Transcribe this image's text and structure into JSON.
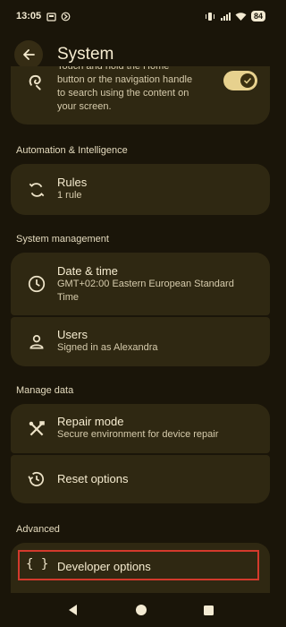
{
  "status_bar": {
    "time": "13:05",
    "battery": "84"
  },
  "app_bar": {
    "title": "System"
  },
  "partial_item": {
    "description_line1": "Touch and hold the Home",
    "description_line2": "button or the navigation handle",
    "description_line3": "to search using the content on",
    "description_line4": "your screen.",
    "toggle_on": true
  },
  "sections": {
    "automation": "Automation & Intelligence",
    "system_management": "System management",
    "manage_data": "Manage data",
    "advanced": "Advanced"
  },
  "items": {
    "rules": {
      "title": "Rules",
      "subtitle": "1 rule"
    },
    "date_time": {
      "title": "Date & time",
      "subtitle_line1": "GMT+02:00 Eastern European Standard",
      "subtitle_line2": "Time"
    },
    "users": {
      "title": "Users",
      "subtitle": "Signed in as Alexandra"
    },
    "repair_mode": {
      "title": "Repair mode",
      "subtitle": "Secure environment for device repair"
    },
    "reset_options": {
      "title": "Reset options"
    },
    "developer_options": {
      "title": "Developer options",
      "icon_text": "{ }"
    }
  },
  "colors": {
    "background": "#1a1509",
    "card": "#2f2812",
    "toggle_track": "#e7d18e",
    "highlight_border": "#d33a2c"
  }
}
